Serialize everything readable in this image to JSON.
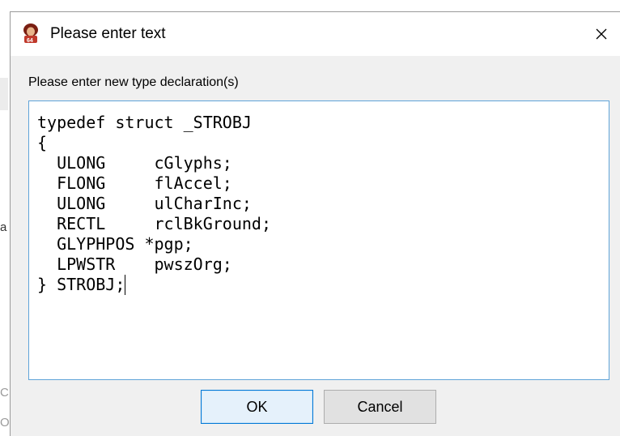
{
  "background_window": {
    "left_edge_chars": [
      "a",
      "C",
      "O"
    ]
  },
  "dialog": {
    "title": "Please enter text",
    "close_glyph": "✕",
    "prompt": "Please enter new type declaration(s)",
    "editor_lines": [
      "typedef struct _STROBJ",
      "{",
      "  ULONG     cGlyphs;",
      "  FLONG     flAccel;",
      "  ULONG     ulCharInc;",
      "  RECTL     rclBkGround;",
      "  GLYPHPOS *pgp;",
      "  LPWSTR    pwszOrg;",
      "} STROBJ;"
    ],
    "buttons": {
      "ok": "OK",
      "cancel": "Cancel"
    }
  },
  "colors": {
    "focus_border": "#0078d7",
    "editor_border": "#5fa3d8",
    "dialog_body": "#f0f0f0"
  }
}
